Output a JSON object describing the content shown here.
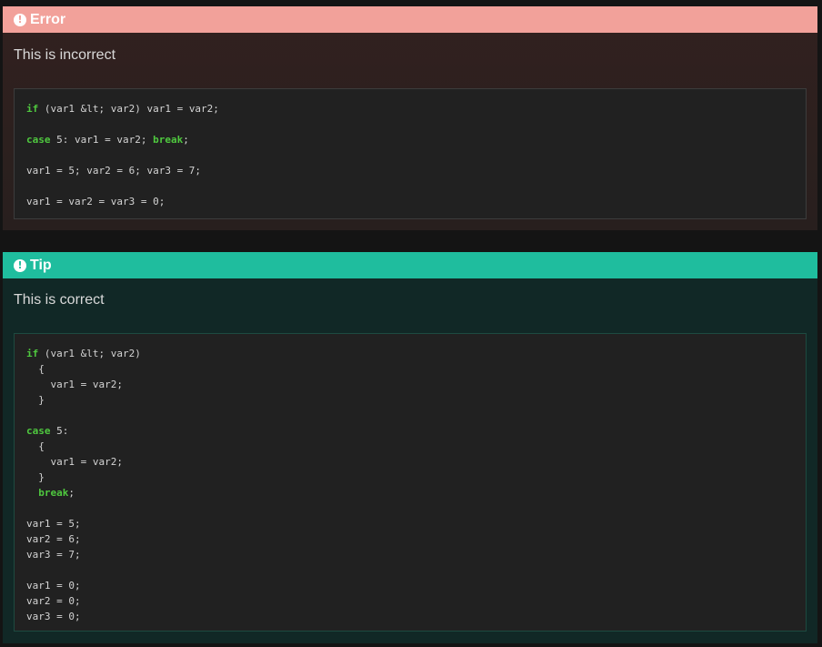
{
  "error": {
    "title": "Error",
    "text": "This is incorrect",
    "code": [
      [
        {
          "t": "if",
          "kw": true
        },
        {
          "t": " (var1 &lt; var2) var1 = var2;"
        }
      ],
      [],
      [
        {
          "t": "case",
          "kw": true
        },
        {
          "t": " 5: var1 = var2; "
        },
        {
          "t": "break",
          "kw": true
        },
        {
          "t": ";"
        }
      ],
      [],
      [
        {
          "t": "var1 = 5; var2 = 6; var3 = 7;"
        }
      ],
      [],
      [
        {
          "t": "var1 = var2 = var3 = 0;"
        }
      ]
    ]
  },
  "tip": {
    "title": "Tip",
    "text": "This is correct",
    "code": [
      [
        {
          "t": "if",
          "kw": true
        },
        {
          "t": " (var1 &lt; var2)"
        }
      ],
      [
        {
          "t": "  {"
        }
      ],
      [
        {
          "t": "    var1 = var2;"
        }
      ],
      [
        {
          "t": "  }"
        }
      ],
      [],
      [
        {
          "t": "case",
          "kw": true
        },
        {
          "t": " 5:"
        }
      ],
      [
        {
          "t": "  {"
        }
      ],
      [
        {
          "t": "    var1 = var2;"
        }
      ],
      [
        {
          "t": "  }"
        }
      ],
      [
        {
          "t": "  "
        },
        {
          "t": "break",
          "kw": true
        },
        {
          "t": ";"
        }
      ],
      [],
      [
        {
          "t": "var1 = 5;"
        }
      ],
      [
        {
          "t": "var2 = 6;"
        }
      ],
      [
        {
          "t": "var3 = 7;"
        }
      ],
      [],
      [
        {
          "t": "var1 = 0;"
        }
      ],
      [
        {
          "t": "var2 = 0;"
        }
      ],
      [
        {
          "t": "var3 = 0;"
        }
      ]
    ]
  },
  "icons": {
    "alert": "exclamation-circle-icon",
    "glyph": "!"
  },
  "colors": {
    "error_header": "#f2a19a",
    "tip_header": "#1fbd9e",
    "keyword": "#4fc83f",
    "code_bg": "#212121"
  }
}
